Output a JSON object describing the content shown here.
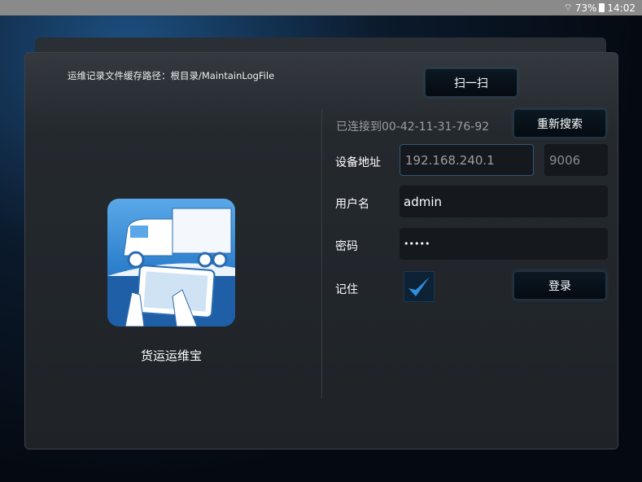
{
  "status_bar": {
    "battery": "73%",
    "time": "14:02"
  },
  "path_label": "运维记录文件缓存路径：根目录/MaintainLogFile",
  "app": {
    "name": "货运运维宝"
  },
  "scan_button": "扫一扫",
  "connection_status": "已连接到00-42-11-31-76-92",
  "research_button": "重新搜索",
  "form": {
    "address_label": "设备地址",
    "address_value": "192.168.240.1",
    "port_value": "9006",
    "username_label": "用户名",
    "username_value": "admin",
    "password_label": "密码",
    "password_value": "•••••",
    "remember_label": "记住",
    "remember_checked": true
  },
  "login_button": "登录"
}
